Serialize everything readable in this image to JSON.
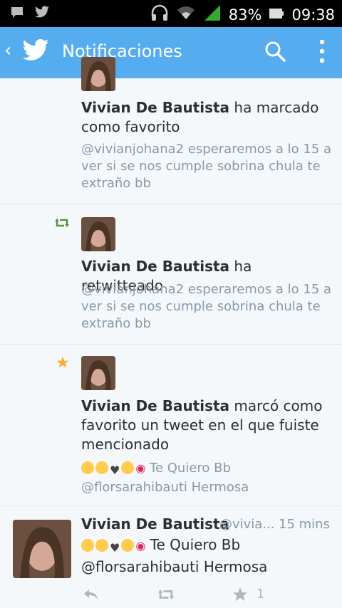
{
  "statusbar": {
    "battery": "83%",
    "time": "09:38"
  },
  "appbar": {
    "title": "Notificaciones"
  },
  "notifications": [
    {
      "name": "Vivian De Bautista",
      "action": " ha marcado como favorito",
      "text": "@vivianjohana2  esperaremos a lo 15 a ver si se nos cumple sobrina chula te extraño bb"
    },
    {
      "name": "Vivian De Bautista",
      "action": " ha retwitteado",
      "text": "@vivianjohana2  esperaremos a lo 15 a ver si se nos cumple sobrina chula te extraño bb"
    },
    {
      "name": "Vivian De Bautista",
      "action": " marcó como favorito un tweet en el que fuiste mencionado",
      "text_main": " Te Quiero Bb",
      "text_line2": "@florsarahibauti Hermosa"
    }
  ],
  "tweet": {
    "name": "Vivian De Bautista",
    "handle": "@vivia...",
    "time": "15 mins",
    "text_main": " Te Quiero Bb",
    "text_line2": "@florsarahibauti Hermosa",
    "favorites": "1"
  },
  "colors": {
    "brand": "#55acee",
    "retweet": "#5c913b",
    "star": "#ffac33"
  }
}
